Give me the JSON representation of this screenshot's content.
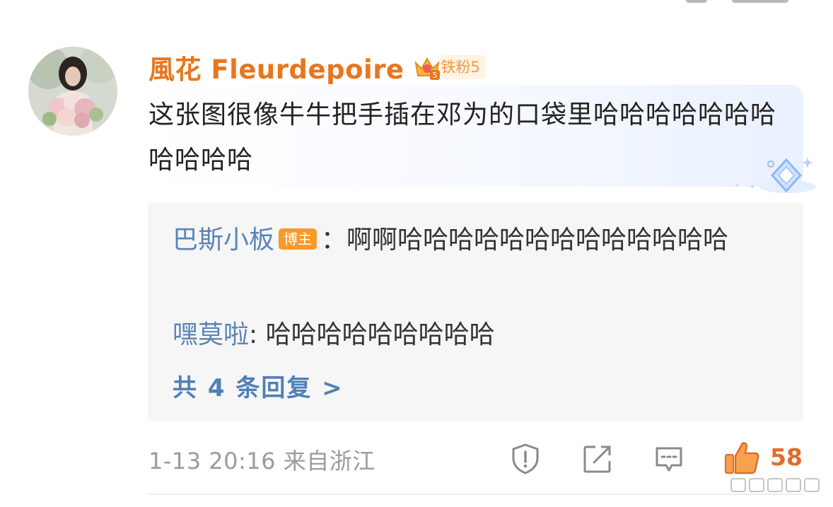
{
  "comment": {
    "username": "風花 Fleurdepoire",
    "fan_badge": "铁粉5",
    "text": "这张图很像牛牛把手插在邓为的口袋里哈哈哈哈哈哈哈哈哈哈哈",
    "timestamp": "1-13 20:16",
    "location": "来自浙江",
    "like_count": "58",
    "colors": {
      "username": "#e8761e",
      "reply_user": "#5a84b5",
      "like": "#e06c2c"
    }
  },
  "replies": {
    "items": [
      {
        "user": "巴斯小板",
        "badge": "博主",
        "separator": "：",
        "text": "啊啊哈哈哈哈哈哈哈哈哈哈哈哈哈"
      },
      {
        "user": "嘿莫啦",
        "separator": ": ",
        "text": "哈哈哈哈哈哈哈哈哈"
      }
    ],
    "more_label": "共 4 条回复 >"
  },
  "icons": {
    "crown": "crown-level-icon",
    "flag": "report-icon",
    "share": "share-icon",
    "comment": "comment-icon",
    "like": "thumbs-up-icon"
  }
}
